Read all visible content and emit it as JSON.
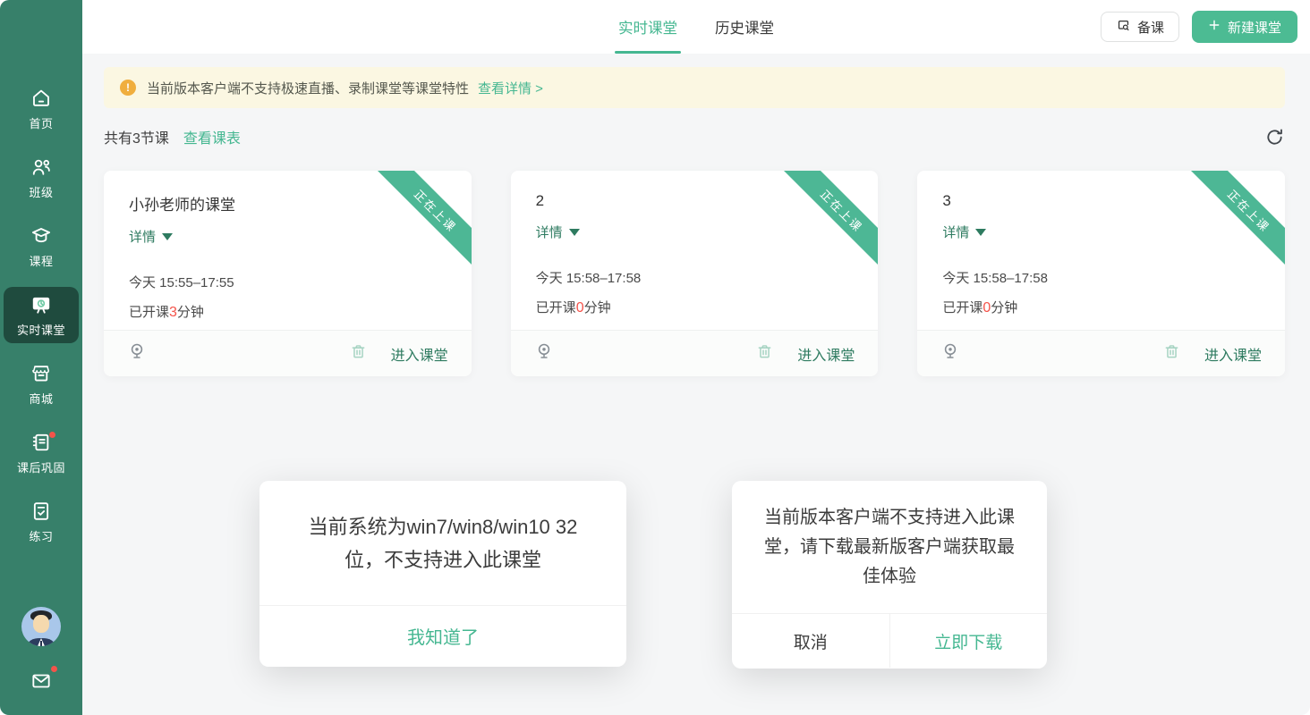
{
  "colors": {
    "sidebar_green": "#37806a",
    "sidebar_active": "#1f4b3e",
    "accent_bright": "#45b791",
    "accent_dark": "#2e7b60",
    "button_green": "#4cbb93",
    "ribbon_green": "#4db795",
    "alert_red": "#f4534a",
    "warning_orange": "#f0ae3e",
    "banner_bg": "#fbf7e2",
    "content_bg": "#f5f6f7"
  },
  "sidebar": {
    "items": [
      {
        "label": "首页",
        "icon": "home-icon"
      },
      {
        "label": "班级",
        "icon": "people-icon"
      },
      {
        "label": "课程",
        "icon": "course-icon"
      },
      {
        "label": "实时课堂",
        "icon": "live-class-icon",
        "active": true
      },
      {
        "label": "商城",
        "icon": "store-icon"
      },
      {
        "label": "课后巩固",
        "icon": "homework-icon",
        "badge": true
      },
      {
        "label": "练习",
        "icon": "practice-icon"
      }
    ],
    "avatar": "teacher-avatar",
    "mail_badge": true
  },
  "topbar": {
    "tabs": [
      {
        "label": "实时课堂",
        "active": true
      },
      {
        "label": "历史课堂",
        "active": false
      }
    ],
    "prepare_button": "备课",
    "new_class_button": "新建课堂",
    "new_class_plus": "+"
  },
  "banner": {
    "text": "当前版本客户端不支持极速直播、录制课堂等课堂特性",
    "link": "查看详情 >",
    "warn_glyph": "!"
  },
  "meta": {
    "count_text": "共有3节课",
    "link": "查看课表"
  },
  "cards": [
    {
      "title": "小孙老师的课堂",
      "detail_label": "详情",
      "time": "今天 15:55–17:55",
      "opened_prefix": "已开课",
      "opened_minutes": "3",
      "opened_suffix": "分钟",
      "ribbon": "正在上课",
      "enter_label": "进入课堂"
    },
    {
      "title": "2",
      "detail_label": "详情",
      "time": "今天 15:58–17:58",
      "opened_prefix": "已开课",
      "opened_minutes": "0",
      "opened_suffix": "分钟",
      "ribbon": "正在上课",
      "enter_label": "进入课堂"
    },
    {
      "title": "3",
      "detail_label": "详情",
      "time": "今天 15:58–17:58",
      "opened_prefix": "已开课",
      "opened_minutes": "0",
      "opened_suffix": "分钟",
      "ribbon": "正在上课",
      "enter_label": "进入课堂"
    }
  ],
  "dialogs": {
    "system": {
      "message": "当前系统为win7/win8/win10 32位，不支持进入此课堂",
      "confirm": "我知道了"
    },
    "download": {
      "message": "当前版本客户端不支持进入此课堂，请下载最新版客户端获取最佳体验",
      "cancel": "取消",
      "confirm": "立即下载"
    }
  }
}
